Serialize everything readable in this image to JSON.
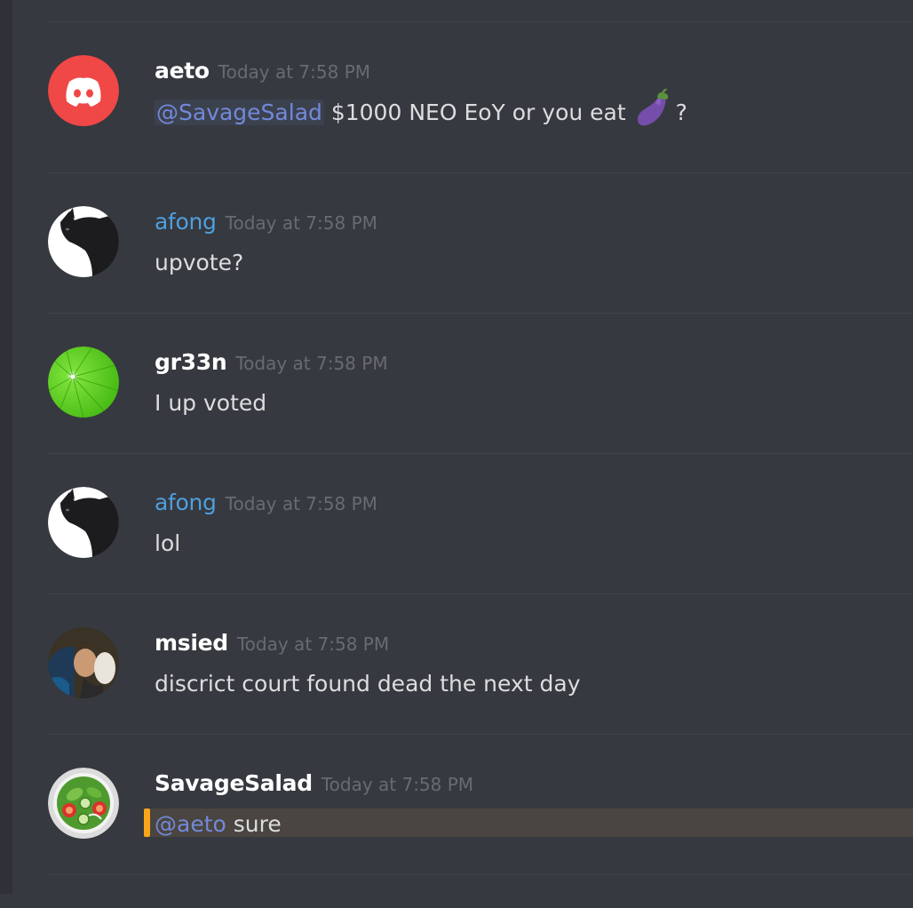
{
  "messages": [
    {
      "username": "aeto",
      "timestamp": "Today at 7:58 PM",
      "mention": "@SavageSalad",
      "text": "$1000 NEO EoY or you eat",
      "emoji": "eggplant-emoji",
      "suffix": "?"
    },
    {
      "username": "afong",
      "timestamp": "Today at 7:58 PM",
      "text": "upvote?"
    },
    {
      "username": "gr33n",
      "timestamp": "Today at 7:58 PM",
      "text": "I up voted"
    },
    {
      "username": "afong",
      "timestamp": "Today at 7:58 PM",
      "text": "lol"
    },
    {
      "username": "msied",
      "timestamp": "Today at 7:58 PM",
      "text": "discrict court found dead the next day"
    },
    {
      "username": "SavageSalad",
      "timestamp": "Today at 7:58 PM",
      "mention": "@aeto",
      "text": "sure"
    }
  ],
  "colors": {
    "background": "#36393f",
    "mention": "#7289da",
    "blue_username": "#4f9fde",
    "highlight_bar": "#faa61a",
    "discord_avatar": "#f04747"
  }
}
